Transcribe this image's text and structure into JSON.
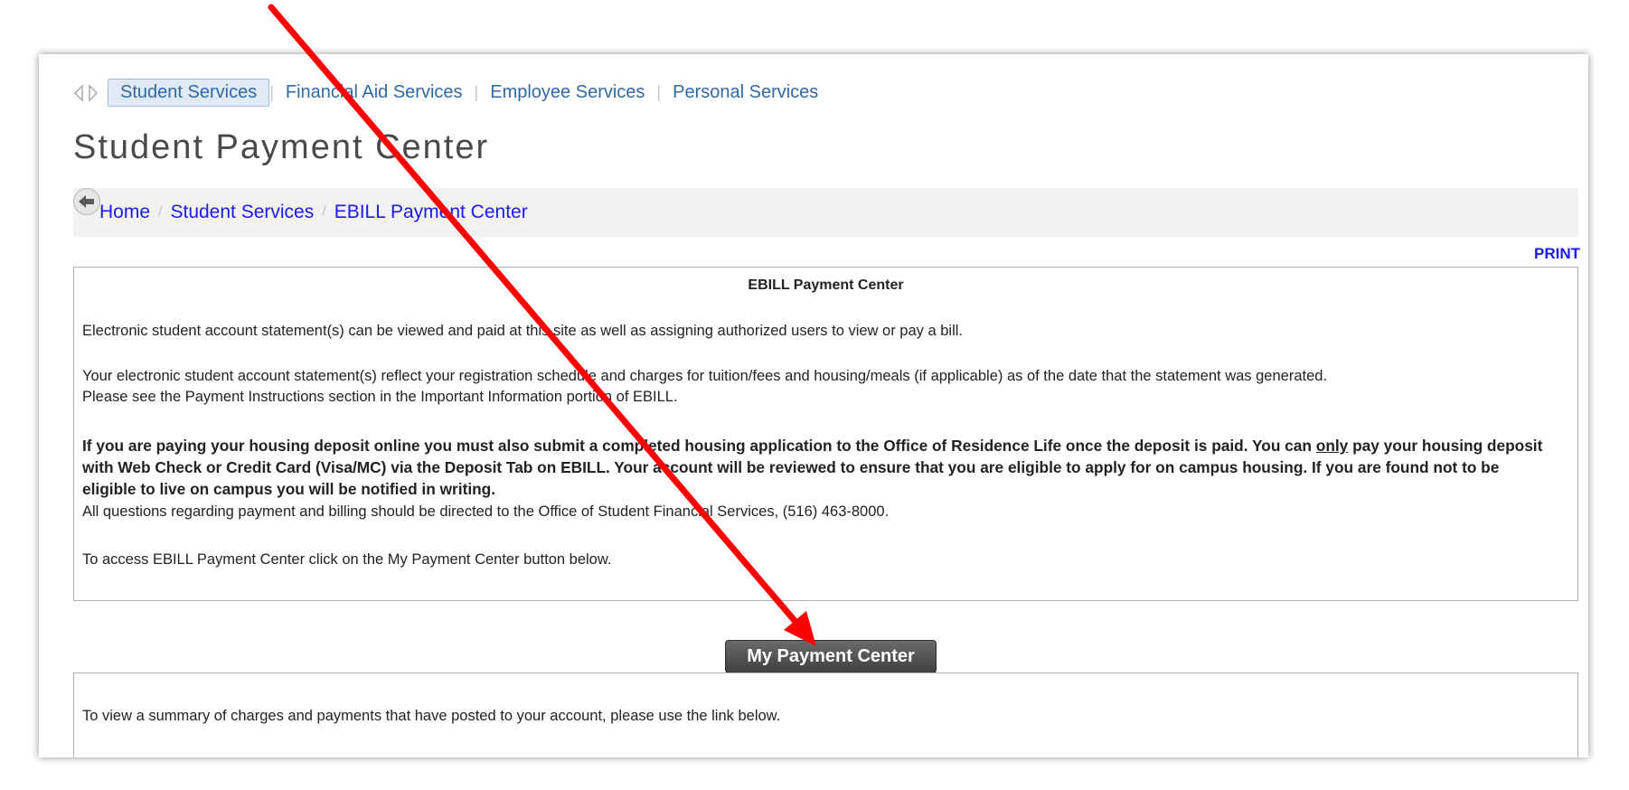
{
  "menu": {
    "items": [
      {
        "label": "Student Services",
        "active": true
      },
      {
        "label": "Financial Aid Services"
      },
      {
        "label": "Employee Services"
      },
      {
        "label": "Personal Services"
      }
    ],
    "separator": "|"
  },
  "page_title": "Student Payment Center",
  "breadcrumb": {
    "items": [
      "Home",
      "Student Services",
      "EBILL Payment Center"
    ],
    "separator": "/"
  },
  "print_label": "PRINT",
  "content": {
    "title": "EBILL Payment Center",
    "p1": "Electronic student account statement(s) can be viewed and paid at this site as well as assigning authorized users to view or pay a bill.",
    "p2_line1": "Your electronic student account statement(s) reflect your registration schedule and charges for tuition/fees and housing/meals (if applicable) as of the date that the statement was generated.",
    "p2_line2": "Please see the Payment Instructions section in the Important Information portion of EBILL.",
    "p3_before": "If you are paying your housing deposit online you must also submit a completed housing application to the Office of Residence Life once the deposit is paid. You can ",
    "p3_only": "only",
    "p3_after": " pay your housing deposit with Web Check or Credit Card (Visa/MC) via the Deposit Tab on EBILL. Your account will be reviewed to ensure that you are eligible to apply for on campus housing. If you are found not to be eligible to live on campus you will be notified in writing.",
    "p4": "All questions regarding payment and billing should be directed to the Office of Student Financial Services, (516) 463-8000.",
    "p5": "To access EBILL Payment Center click on the My Payment Center button below."
  },
  "payment_button": "My Payment Center",
  "lower": {
    "text": "To view a summary of charges and payments that have posted to your account, please use the link below."
  },
  "colors": {
    "link": "#1a1aee",
    "menu_link": "#2f6aa5",
    "arrow": "#ff0000",
    "button": "#4a4a4a"
  }
}
